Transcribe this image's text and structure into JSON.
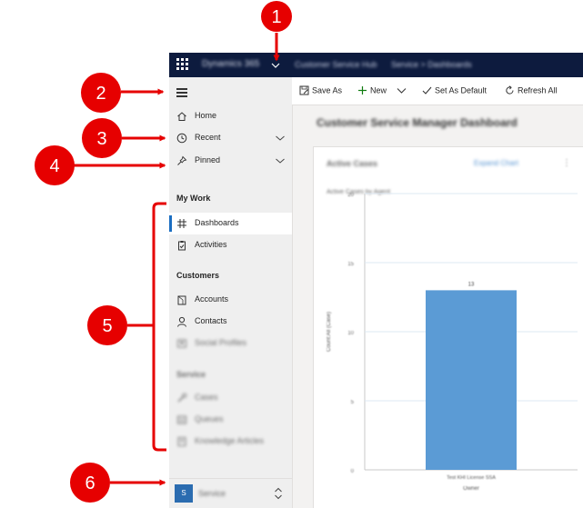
{
  "topbar": {
    "app_name": "Dynamics 365",
    "hub_name": "Customer Service Hub",
    "breadcrumb": "Service > Dashboards"
  },
  "sidebar": {
    "items": [
      {
        "label": "Home",
        "icon": "home-icon"
      },
      {
        "label": "Recent",
        "icon": "clock-icon"
      },
      {
        "label": "Pinned",
        "icon": "pin-icon"
      }
    ],
    "sections": [
      {
        "title": "My Work",
        "items": [
          {
            "label": "Dashboards",
            "icon": "dashboard-icon",
            "selected": true
          },
          {
            "label": "Activities",
            "icon": "clipboard-icon"
          }
        ]
      },
      {
        "title": "Customers",
        "items": [
          {
            "label": "Accounts",
            "icon": "building-icon"
          },
          {
            "label": "Contacts",
            "icon": "person-icon"
          },
          {
            "label": "Social Profiles",
            "icon": "profile-icon"
          }
        ]
      },
      {
        "title": "Service",
        "items": [
          {
            "label": "Cases",
            "icon": "wrench-icon"
          },
          {
            "label": "Queues",
            "icon": "queue-icon"
          },
          {
            "label": "Knowledge Articles",
            "icon": "book-icon"
          }
        ]
      }
    ],
    "area": {
      "initial": "S",
      "name": "Service"
    }
  },
  "commandbar": {
    "save_as": "Save As",
    "new": "New",
    "set_default": "Set As Default",
    "refresh_all": "Refresh All"
  },
  "dashboard": {
    "title": "Customer Service Manager Dashboard",
    "card_title": "Active Cases",
    "expand_label": "Expand Chart"
  },
  "chart_data": {
    "type": "bar",
    "title": "Active Cases by Agent",
    "categories": [
      "Test KHI License SSA"
    ],
    "values": [
      13
    ],
    "value_label": "13",
    "xlabel": "Owner",
    "ylabel": "Count:All (Case)",
    "ylim": [
      0,
      20
    ],
    "yticks": [
      0,
      5,
      10,
      15,
      20
    ],
    "bar_color": "#5b9bd5",
    "grid": true
  },
  "callouts": [
    {
      "number": "1"
    },
    {
      "number": "2"
    },
    {
      "number": "3"
    },
    {
      "number": "4"
    },
    {
      "number": "5"
    },
    {
      "number": "6"
    }
  ],
  "colors": {
    "topbar": "#0d1b3e",
    "accent": "#1b6ec2",
    "callout": "#e60000"
  }
}
